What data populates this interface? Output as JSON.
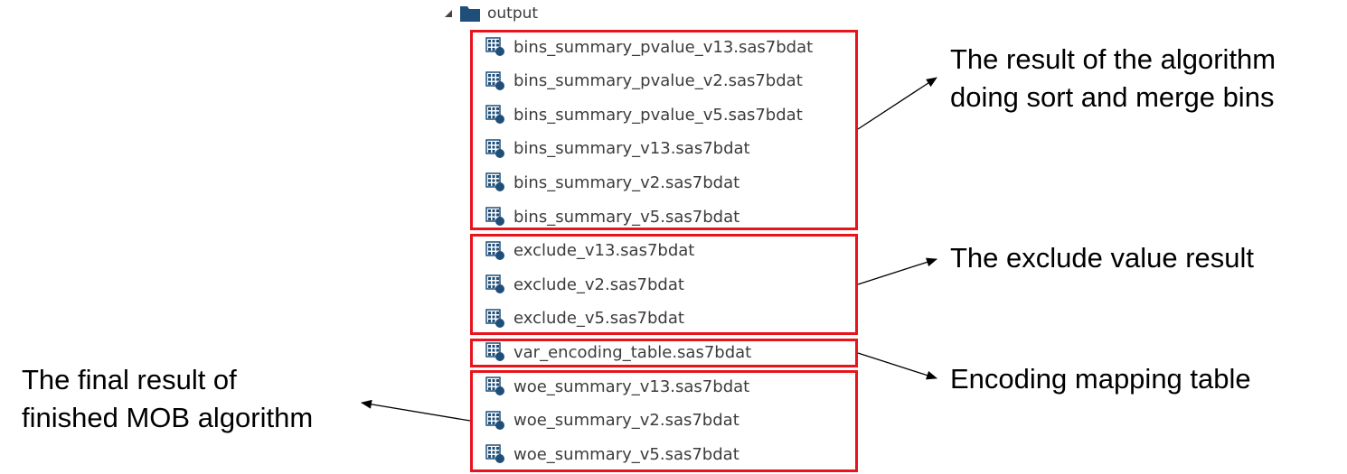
{
  "tree": {
    "root_label": "output",
    "files": [
      "bins_summary_pvalue_v13.sas7bdat",
      "bins_summary_pvalue_v2.sas7bdat",
      "bins_summary_pvalue_v5.sas7bdat",
      "bins_summary_v13.sas7bdat",
      "bins_summary_v2.sas7bdat",
      "bins_summary_v5.sas7bdat",
      "exclude_v13.sas7bdat",
      "exclude_v2.sas7bdat",
      "exclude_v5.sas7bdat",
      "var_encoding_table.sas7bdat",
      "woe_summary_v13.sas7bdat",
      "woe_summary_v2.sas7bdat",
      "woe_summary_v5.sas7bdat"
    ]
  },
  "annotations": {
    "sort_merge_line1": "The result of the algorithm",
    "sort_merge_line2": "doing sort and merge bins",
    "exclude": "The exclude value result",
    "encoding": "Encoding mapping table",
    "final_line1": "The final result of",
    "final_line2": "finished MOB algorithm"
  },
  "colors": {
    "highlight_box": "#e8141b",
    "folder_icon": "#1f4e79",
    "dataset_icon": "#1f4e79",
    "text": "#3c3c3c"
  },
  "icons": {
    "expand_toggle": "triangle-down-icon",
    "folder": "folder-icon",
    "dataset": "sas-dataset-icon"
  }
}
